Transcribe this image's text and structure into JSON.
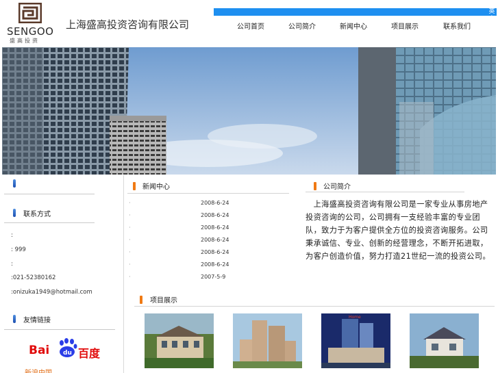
{
  "header": {
    "logo_text": "SENGOO",
    "logo_sub": "盛高投资",
    "site_title": "上海盛高投资咨询有限公司",
    "topbar_button": "英文"
  },
  "nav": {
    "items": [
      {
        "label": "公司首页"
      },
      {
        "label": "公司简介"
      },
      {
        "label": "新闻中心"
      },
      {
        "label": "项目展示"
      },
      {
        "label": "联系我们"
      }
    ]
  },
  "sidebar": {
    "top_heading": "",
    "contact_heading": "联系方式",
    "contact_lines": [
      ":",
      ":    999",
      ":",
      ":021-52380162",
      ":onizuka1949@hotmail.com"
    ],
    "links_heading": "友情链接",
    "baidu_logo_text": "Bai百度",
    "ad2_text": "新浪中国"
  },
  "news": {
    "heading": "新闻中心",
    "items": [
      {
        "title": "·",
        "date": "2008-6-24"
      },
      {
        "title": "·",
        "date": "2008-6-24"
      },
      {
        "title": "·",
        "date": "2008-6-24"
      },
      {
        "title": "·",
        "date": "2008-6-24"
      },
      {
        "title": "·",
        "date": "2008-6-24"
      },
      {
        "title": "·",
        "date": "2008-6-24"
      },
      {
        "title": "·",
        "date": "2007-5-9"
      }
    ]
  },
  "about": {
    "heading": "公司简介",
    "text": "　上海盛高投资咨询有限公司是一家专业从事房地产投资咨询的公司，公司拥有一支经验丰富的专业团队，致力于为客户提供全方位的投资咨询服务。公司秉承诚信、专业、创新的经营理念，不断开拓进取，为客户创造价值，努力打造21世纪一流的投资公司。"
  },
  "projects": {
    "heading": "项目展示"
  },
  "colors": {
    "accent_blue": "#1e8ff0",
    "section_orange": "#f07a14",
    "baidu_red": "#e10a0a"
  }
}
